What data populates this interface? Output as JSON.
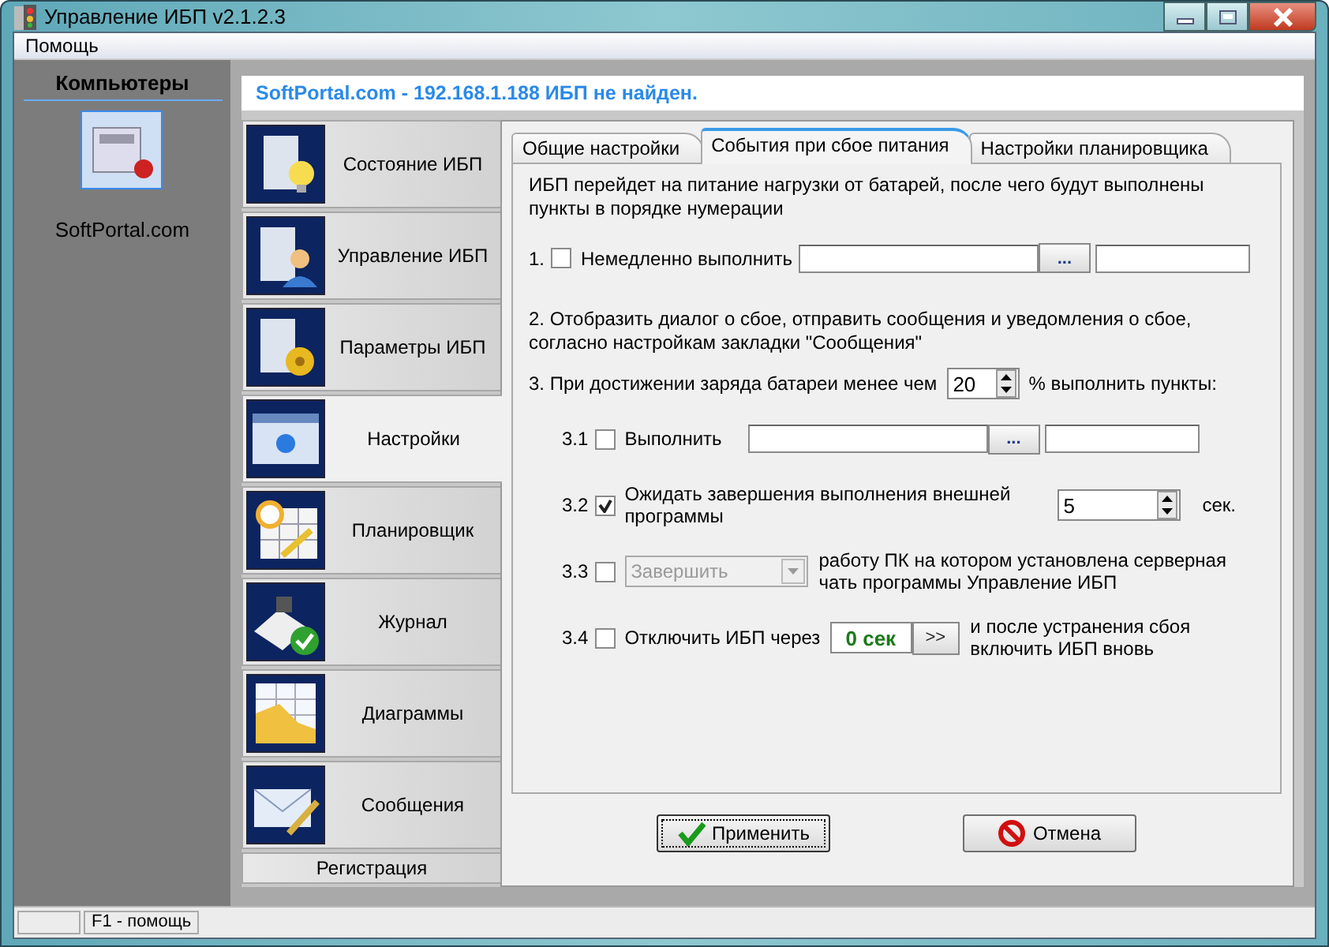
{
  "window": {
    "title": "Управление ИБП v2.1.2.3"
  },
  "menu": [
    {
      "label": "Помощь"
    }
  ],
  "computers": {
    "title": "Компьютеры",
    "items": [
      {
        "label": "SoftPortal.com",
        "selected": true
      }
    ]
  },
  "header": "SoftPortal.com - 192.168.1.188 ИБП не найден.",
  "nav": [
    {
      "label": "Состояние ИБП",
      "kind": "large",
      "selected": false
    },
    {
      "label": "Управление ИБП",
      "kind": "large",
      "selected": false
    },
    {
      "label": "Параметры ИБП",
      "kind": "large",
      "selected": false
    },
    {
      "label": "Настройки",
      "kind": "large",
      "selected": true
    },
    {
      "label": "Планировщик",
      "kind": "large",
      "selected": false
    },
    {
      "label": "Журнал",
      "kind": "large",
      "selected": false
    },
    {
      "label": "Диаграммы",
      "kind": "large",
      "selected": false
    },
    {
      "label": "Сообщения",
      "kind": "large",
      "selected": false
    },
    {
      "label": "Регистрация",
      "kind": "small",
      "selected": false
    }
  ],
  "tabs": [
    {
      "label": "Общие настройки",
      "selected": false
    },
    {
      "label": "События при сбое питания",
      "selected": true
    },
    {
      "label": "Настройки планировщика",
      "selected": false
    }
  ],
  "intro": "ИБП перейдет на питание нагрузки от батарей, после чего будут выполнены пункты в порядке нумерации",
  "step1": {
    "number": "1.",
    "checked": false,
    "label": "Немедленно выполнить",
    "browse": "..."
  },
  "step2": "2. Отобразить диалог о сбое, отправить сообщения и уведомления о сбое, согласно настройкам закладки \"Сообщения\"",
  "step3": {
    "label": "3. При достижении заряда батареи менее чем",
    "value": "20",
    "suffix": "% выполнить пункты:"
  },
  "substeps": [
    {
      "kind": "exec",
      "number": "3.1",
      "checked": false,
      "label": "Выполнить",
      "browse": "..."
    },
    {
      "kind": "wait",
      "number": "3.2",
      "checked": true,
      "label": "Ожидать завершения выполнения внешней программы",
      "value": "5",
      "unit": "сек."
    },
    {
      "kind": "shutdown",
      "number": "3.3",
      "checked": false,
      "select": "Завершить",
      "disabled": true,
      "label": "работу ПК на котором установлена серверная чать программы Управление ИБП"
    },
    {
      "kind": "upsoff",
      "number": "3.4",
      "checked": false,
      "label": "Отключить ИБП через",
      "value": "0 сек",
      "button": ">>",
      "after": "и после устранения сбоя включить ИБП вновь"
    }
  ],
  "buttons": [
    {
      "label": "Применить",
      "kind": "ok",
      "focused": true
    },
    {
      "label": "Отмена",
      "kind": "cancel",
      "focused": false
    }
  ],
  "status_bar": {
    "text": "F1 - помощь"
  }
}
